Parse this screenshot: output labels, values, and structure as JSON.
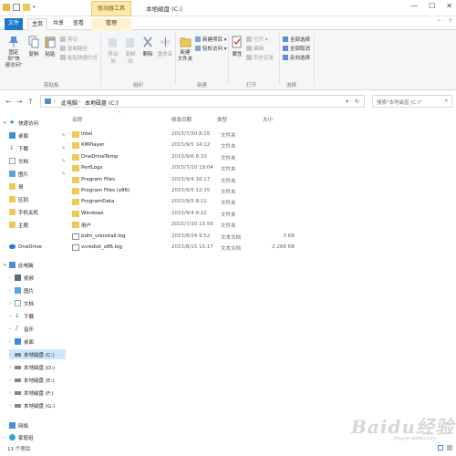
{
  "window": {
    "title": "本地磁盘 (C:)",
    "context_tab": "驱动器工具",
    "minimize": "—",
    "maximize": "☐",
    "close": "✕"
  },
  "tabs": {
    "file": "文件",
    "home": "主页",
    "share": "共享",
    "view": "查看",
    "manage": "管理"
  },
  "ribbon": {
    "pin": "固定到\"快\n速访问\"",
    "copy": "复制",
    "paste": "粘贴",
    "copy_path": "复制路径",
    "paste_shortcut": "粘贴快捷方式",
    "cut": "剪切",
    "move_to": "移动到",
    "copy_to": "复制到",
    "delete": "删除",
    "rename": "重命名",
    "new_folder": "新建\n文件夹",
    "new_item": "新建项目 ▾",
    "easy_access": "轻松访问 ▾",
    "properties": "属性",
    "open": "打开 ▾",
    "edit": "编辑",
    "history": "历史记录",
    "select_all": "全部选择",
    "select_none": "全部取消",
    "invert": "反向选择",
    "group_clipboard": "剪贴板",
    "group_organize": "组织",
    "group_new": "新建",
    "group_open": "打开",
    "group_select": "选择",
    "collapse": "⌃",
    "help": "?"
  },
  "address": {
    "back": "←",
    "forward": "→",
    "up": "↑",
    "crumbs": [
      "此电脑",
      "本地磁盘 (C:)"
    ],
    "search_placeholder": "搜索\"本地磁盘 (C:)\""
  },
  "nav": {
    "quick_access": "快速访问",
    "quick_items": [
      "桌面",
      "下载",
      "文档",
      "图片",
      "哥",
      "区别",
      "手机关机",
      "主题"
    ],
    "onedrive": "OneDrive",
    "this_pc": "此电脑",
    "pc_items": [
      "视频",
      "图片",
      "文档",
      "下载",
      "音乐",
      "桌面",
      "本地磁盘 (C:)",
      "本地磁盘 (D:)",
      "本地磁盘 (E:)",
      "本地磁盘 (F:)",
      "本地磁盘 (G:)"
    ],
    "network": "网络",
    "homegroup": "家庭组"
  },
  "columns": {
    "name": "名称",
    "date": "修改日期",
    "type": "类型",
    "size": "大小"
  },
  "files": [
    {
      "name": "Intel",
      "date": "2015/7/30 8:15",
      "type": "文件夹",
      "size": "",
      "kind": "folder"
    },
    {
      "name": "KMPlayer",
      "date": "2015/9/5 14:12",
      "type": "文件夹",
      "size": "",
      "kind": "folder"
    },
    {
      "name": "OneDriveTemp",
      "date": "2015/9/6 8:10",
      "type": "文件夹",
      "size": "",
      "kind": "folder"
    },
    {
      "name": "PerfLogs",
      "date": "2015/7/10 19:04",
      "type": "文件夹",
      "size": "",
      "kind": "folder"
    },
    {
      "name": "Program Files",
      "date": "2015/9/4 16:17",
      "type": "文件夹",
      "size": "",
      "kind": "folder"
    },
    {
      "name": "Program Files (x86)",
      "date": "2015/9/5 12:35",
      "type": "文件夹",
      "size": "",
      "kind": "folder"
    },
    {
      "name": "ProgramData",
      "date": "2015/9/5 8:11",
      "type": "文件夹",
      "size": "",
      "kind": "folder"
    },
    {
      "name": "Windows",
      "date": "2015/9/4 8:22",
      "type": "文件夹",
      "size": "",
      "kind": "folder"
    },
    {
      "name": "用户",
      "date": "2015/7/30 15:56",
      "type": "文件夹",
      "size": "",
      "kind": "folder"
    },
    {
      "name": "bdm_uninstall.log",
      "date": "2015/8/24 9:52",
      "type": "文本文档",
      "size": "3 KB",
      "kind": "doc"
    },
    {
      "name": "vcredist_x86.log",
      "date": "2015/8/15 15:17",
      "type": "文本文档",
      "size": "2,288 KB",
      "kind": "doc"
    }
  ],
  "status": {
    "count": "11 个项目"
  },
  "watermark": {
    "brand": "Baidu经验",
    "sub": "jingyan.baidu.com"
  }
}
